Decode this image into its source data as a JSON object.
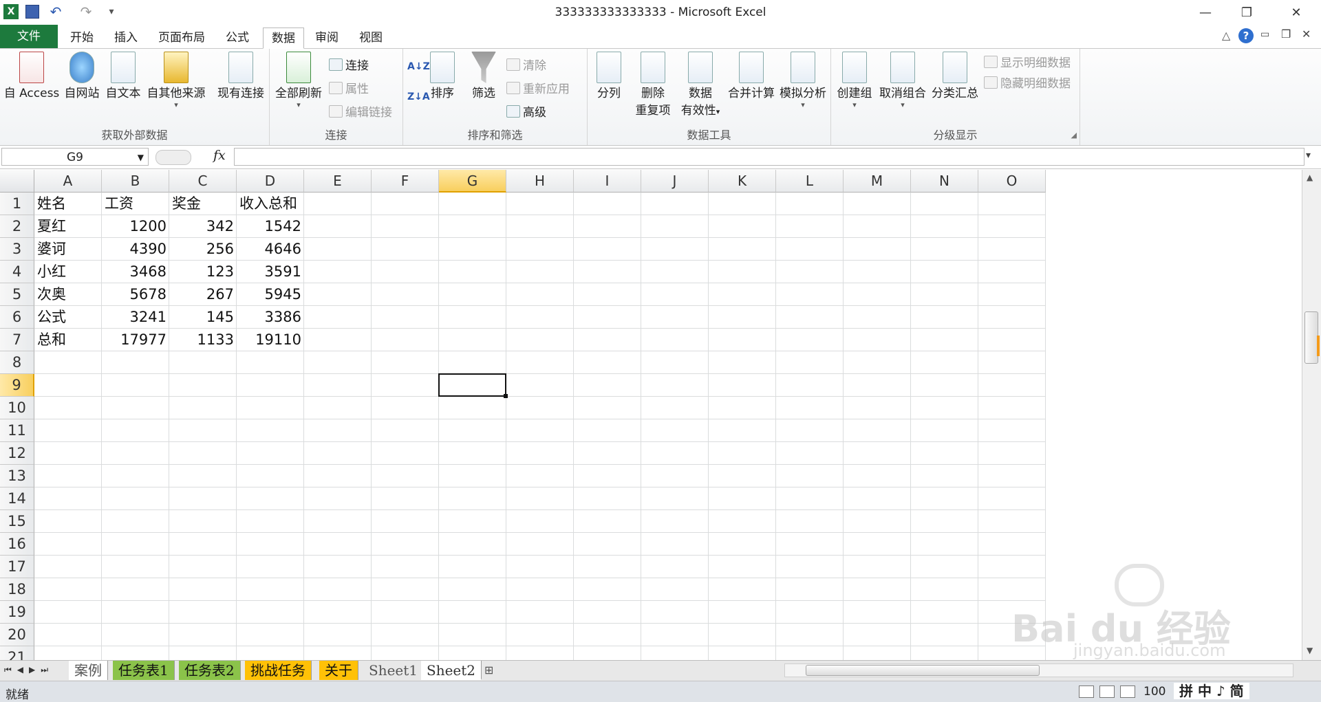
{
  "window": {
    "title": "333333333333333 - Microsoft Excel"
  },
  "tabs": [
    "文件",
    "开始",
    "插入",
    "页面布局",
    "公式",
    "数据",
    "审阅",
    "视图"
  ],
  "ribbon": {
    "groups": {
      "external": "获取外部数据",
      "connections": "连接",
      "sort_filter": "排序和筛选",
      "data_tools": "数据工具",
      "outline": "分级显示"
    },
    "buttons": {
      "from_access": "自 Access",
      "from_web": "自网站",
      "from_text": "自文本",
      "from_other": "自其他来源",
      "existing_conn": "现有连接",
      "refresh_all": "全部刷新",
      "connections": "连接",
      "properties": "属性",
      "edit_links": "编辑链接",
      "sort": "排序",
      "filter": "筛选",
      "clear": "清除",
      "reapply": "重新应用",
      "advanced": "高级",
      "text_to_columns": "分列",
      "remove_dup_1": "删除",
      "remove_dup_2": "重复项",
      "validation_1": "数据",
      "validation_2": "有效性",
      "consolidate": "合并计算",
      "what_if": "模拟分析",
      "group": "创建组",
      "ungroup": "取消组合",
      "subtotal": "分类汇总",
      "show_detail": "显示明细数据",
      "hide_detail": "隐藏明细数据"
    }
  },
  "formula_bar": {
    "name_box": "G9",
    "fx": "fx",
    "formula": ""
  },
  "columns": [
    "A",
    "B",
    "C",
    "D",
    "E",
    "F",
    "G",
    "H",
    "I",
    "J",
    "K",
    "L",
    "M",
    "N",
    "O"
  ],
  "rows": [
    "1",
    "2",
    "3",
    "4",
    "5",
    "6",
    "7",
    "8",
    "9",
    "10",
    "11",
    "12",
    "13",
    "14",
    "15",
    "16",
    "17",
    "18",
    "19",
    "20",
    "21"
  ],
  "selected_cell": "G9",
  "table": [
    [
      "姓名",
      "工资",
      "奖金",
      "收入总和"
    ],
    [
      "夏红",
      "1200",
      "342",
      "1542"
    ],
    [
      "婆诃",
      "4390",
      "256",
      "4646"
    ],
    [
      "小红",
      "3468",
      "123",
      "3591"
    ],
    [
      "次奥",
      "5678",
      "267",
      "5945"
    ],
    [
      "公式",
      "3241",
      "145",
      "3386"
    ],
    [
      "总和",
      "17977",
      "1133",
      "19110"
    ]
  ],
  "sheets": [
    "案例",
    "任务表1",
    "任务表2",
    "挑战任务",
    "关于",
    "Sheet1",
    "Sheet2"
  ],
  "status": {
    "ready": "就绪",
    "zoom": "100",
    "ime": "拼 中 ♪ 简"
  },
  "watermark": {
    "logo": "Bai du 经验",
    "url": "jingyan.baidu.com"
  }
}
